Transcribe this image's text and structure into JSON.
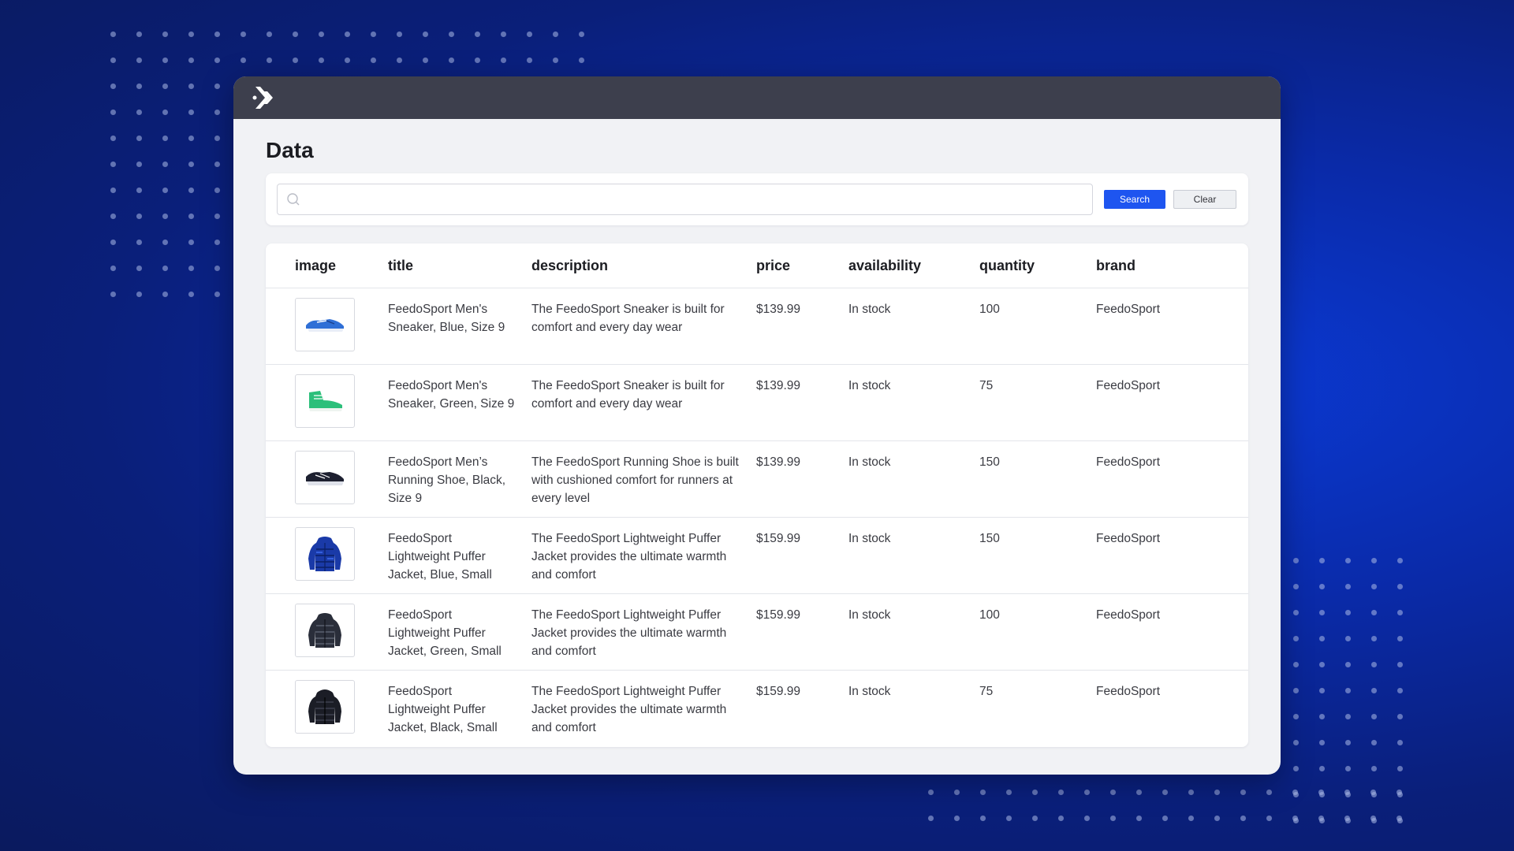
{
  "window": {
    "logo": "feedonomics-chevron-logo"
  },
  "page": {
    "title": "Data"
  },
  "search": {
    "placeholder": "",
    "value": "",
    "search_label": "Search",
    "clear_label": "Clear"
  },
  "table": {
    "headers": {
      "image": "image",
      "title": "title",
      "description": "description",
      "price": "price",
      "availability": "availability",
      "quantity": "quantity",
      "brand": "brand"
    },
    "rows": [
      {
        "image": "blue-sneaker-image",
        "title": "FeedoSport Men's Sneaker, Blue, Size 9",
        "description": "The FeedoSport Sneaker is built for comfort and every day wear",
        "price": "$139.99",
        "availability": "In stock",
        "quantity": "100",
        "brand": "FeedoSport"
      },
      {
        "image": "green-sneaker-image",
        "title": "FeedoSport Men's Sneaker, Green, Size 9",
        "description": "The FeedoSport Sneaker is built for comfort and every day wear",
        "price": "$139.99",
        "availability": "In stock",
        "quantity": "75",
        "brand": "FeedoSport"
      },
      {
        "image": "black-running-shoe-image",
        "title": "FeedoSport Men’s Running Shoe, Black, Size 9",
        "description": "The FeedoSport Running Shoe is built with cushioned comfort for runners at every level",
        "price": "$139.99",
        "availability": "In stock",
        "quantity": "150",
        "brand": "FeedoSport"
      },
      {
        "image": "blue-puffer-jacket-image",
        "title": "FeedoSport Lightweight Puffer Jacket, Blue, Small",
        "description": "The FeedoSport Lightweight Puffer Jacket provides the ultimate warmth and comfort",
        "price": "$159.99",
        "availability": "In stock",
        "quantity": "150",
        "brand": "FeedoSport"
      },
      {
        "image": "green-puffer-jacket-image",
        "title": "FeedoSport Lightweight Puffer Jacket, Green, Small",
        "description": "The FeedoSport Lightweight Puffer Jacket provides the ultimate warmth and comfort",
        "price": "$159.99",
        "availability": "In stock",
        "quantity": "100",
        "brand": "FeedoSport"
      },
      {
        "image": "black-puffer-jacket-image",
        "title": "FeedoSport Lightweight Puffer Jacket, Black, Small",
        "description": "The FeedoSport Lightweight Puffer Jacket provides the ultimate warmth and comfort",
        "price": "$159.99",
        "availability": "In stock",
        "quantity": "75",
        "brand": "FeedoSport"
      }
    ]
  },
  "colors": {
    "accent": "#1e55f0",
    "titlebar": "#3d3f4d",
    "background": "#0a2aa8"
  }
}
